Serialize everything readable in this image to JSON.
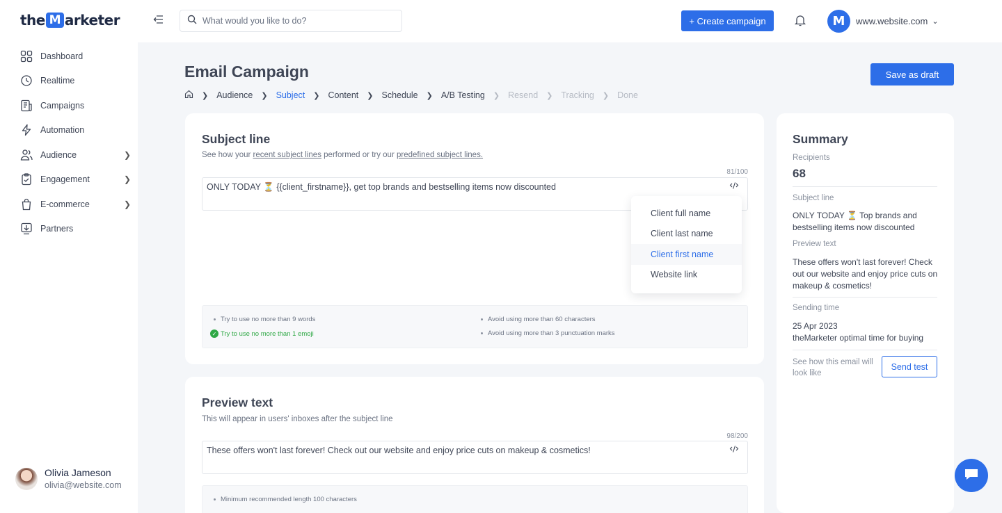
{
  "brand": {
    "logo_prefix": "the",
    "logo_letter": "M",
    "logo_suffix": "arketer"
  },
  "colors": {
    "accent": "#2d6ee8",
    "success": "#2fa845",
    "text": "#3f4656",
    "muted": "#6b7383",
    "background": "#f4f6f9"
  },
  "sidebar": {
    "items": [
      {
        "label": "Dashboard",
        "icon": "grid-icon"
      },
      {
        "label": "Realtime",
        "icon": "clock-icon"
      },
      {
        "label": "Campaigns",
        "icon": "document-icon"
      },
      {
        "label": "Automation",
        "icon": "lightning-icon"
      },
      {
        "label": "Audience",
        "icon": "users-icon"
      },
      {
        "label": "Engagement",
        "icon": "clipboard-check-icon"
      },
      {
        "label": "E-commerce",
        "icon": "shopping-bag-icon"
      },
      {
        "label": "Partners",
        "icon": "partners-icon"
      }
    ],
    "user": {
      "name": "Olivia Jameson",
      "email": "olivia@website.com"
    }
  },
  "topbar": {
    "search_placeholder": "What would you like to do?",
    "create_label": "+ Create campaign",
    "site_initial": "M",
    "site_name": "www.website.com"
  },
  "header": {
    "title": "Email Campaign",
    "save_label": "Save as draft",
    "steps": [
      {
        "label": "Audience",
        "state": "done"
      },
      {
        "label": "Subject",
        "state": "active"
      },
      {
        "label": "Content",
        "state": "todo"
      },
      {
        "label": "Schedule",
        "state": "todo"
      },
      {
        "label": "A/B Testing",
        "state": "todo"
      },
      {
        "label": "Resend",
        "state": "disabled"
      },
      {
        "label": "Tracking",
        "state": "disabled"
      },
      {
        "label": "Done",
        "state": "disabled"
      }
    ]
  },
  "subject": {
    "title": "Subject line",
    "sub_prefix": "See how your ",
    "sub_link1": "recent subject lines",
    "sub_mid": " performed or try our ",
    "sub_link2": "predefined subject lines.",
    "counter": "81/100",
    "value": "ONLY TODAY ⏳ {{client_firstname}}, get top brands and bestselling items now discounted",
    "tips": {
      "words": "Try to use no more than 9 words",
      "emoji": "Try to use no more than 1 emoji",
      "chars": "Avoid using more than 60 characters",
      "punct": "Avoid using more than 3 punctuation marks"
    }
  },
  "dropdown": {
    "items": [
      "Client full name",
      "Client last name",
      "Client first name",
      "Website link"
    ],
    "active_index": 2
  },
  "preview": {
    "title": "Preview text",
    "sub": "This will appear in users' inboxes after the subject line",
    "counter": "98/200",
    "value": "These offers won't last forever! Check out our website and enjoy price cuts on makeup & cosmetics!",
    "tip": "Minimum recommended length 100 characters"
  },
  "summary": {
    "title": "Summary",
    "recipients_label": "Recipients",
    "recipients_value": "68",
    "subject_label": "Subject line",
    "subject_value": "ONLY TODAY ⏳ Top brands and bestselling items now discounted",
    "preview_label": "Preview text",
    "preview_value": "These offers won't last forever! Check out our website and enjoy price cuts on makeup & cosmetics!",
    "sending_label": "Sending time",
    "sending_date": "25 Apr 2023",
    "sending_note": "theMarketer optimal time for buying",
    "test_hint": "See how this email will look like",
    "send_test_label": "Send test"
  }
}
